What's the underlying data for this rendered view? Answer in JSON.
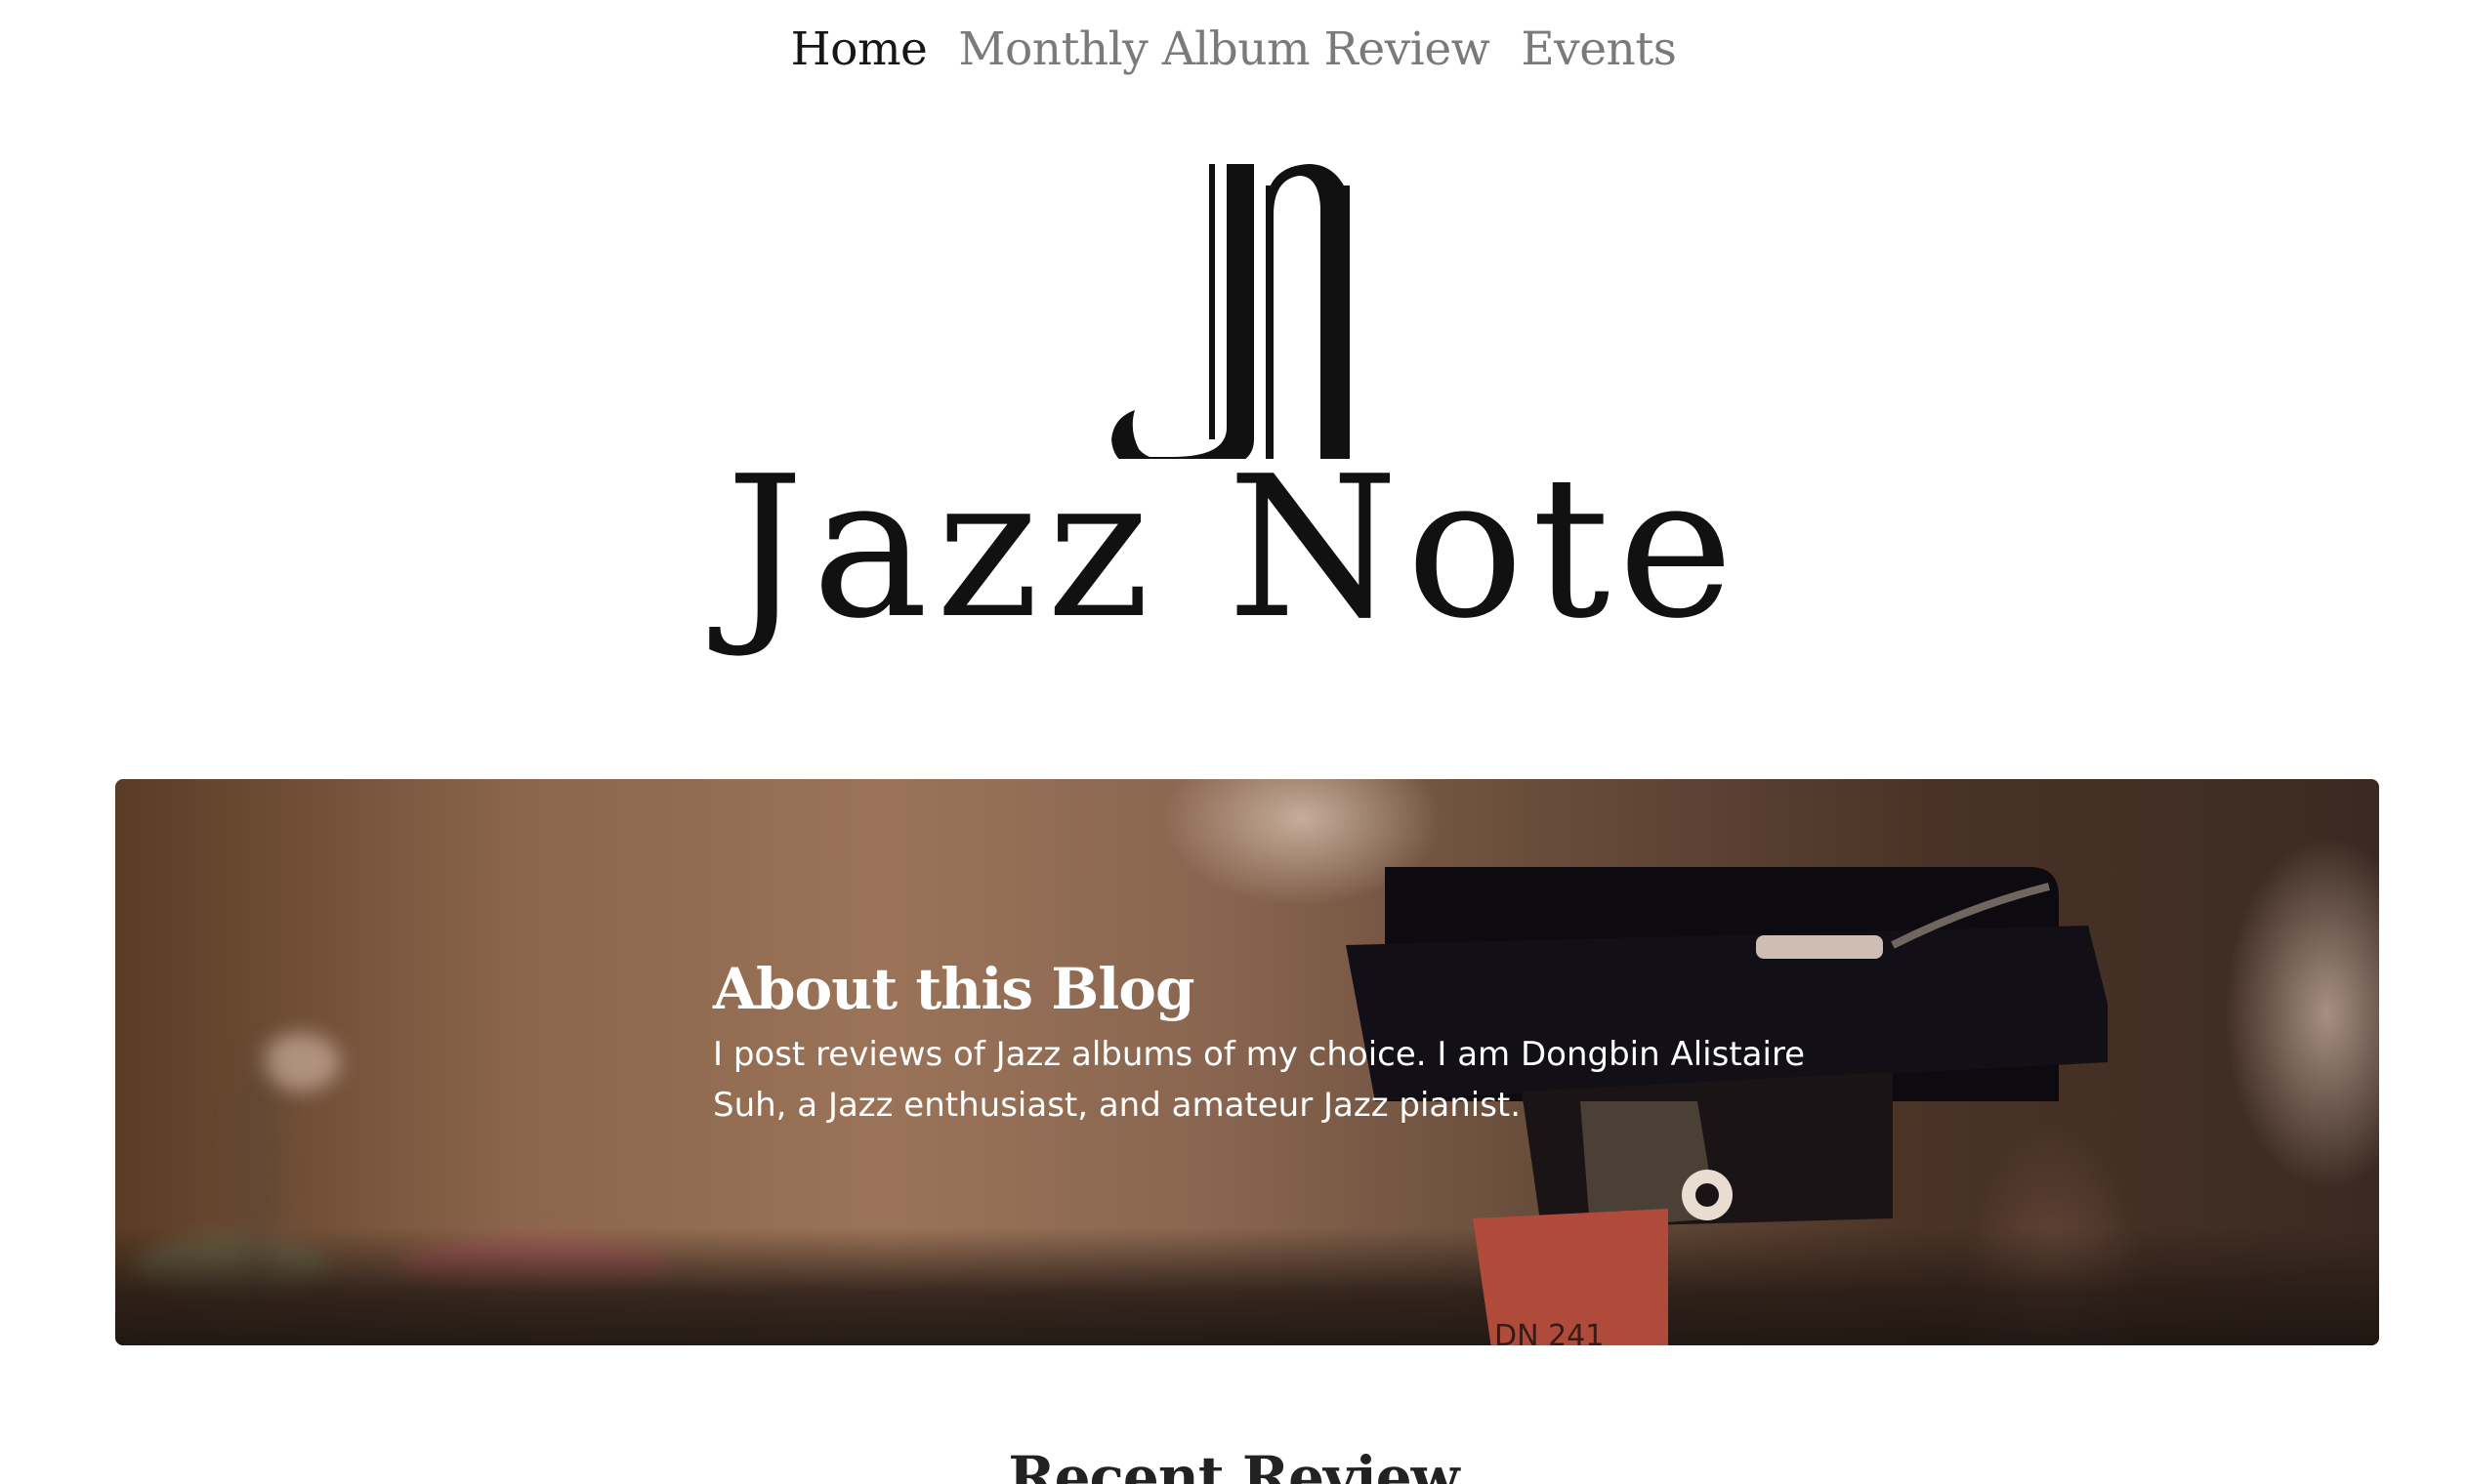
{
  "nav": {
    "items": [
      {
        "label": "Home",
        "active": true
      },
      {
        "label": "Monthly Album Review",
        "active": false
      },
      {
        "label": "Events",
        "active": false
      }
    ]
  },
  "brand": {
    "monogram": "JN",
    "name": "Jazz Note"
  },
  "hero": {
    "title": "About this Blog",
    "body": "I post reviews of Jazz albums of my choice. I am Dongbin Alistaire Suh, a Jazz enthusiast, and amateur Jazz pianist.",
    "cartridge_label": "DN 241"
  },
  "recent": {
    "heading": "Recent Review"
  },
  "colors": {
    "nav_active": "#161616",
    "nav_inactive": "#7a7a7a",
    "logo": "#111111",
    "hero_text": "#ffffff",
    "heading": "#222222"
  }
}
